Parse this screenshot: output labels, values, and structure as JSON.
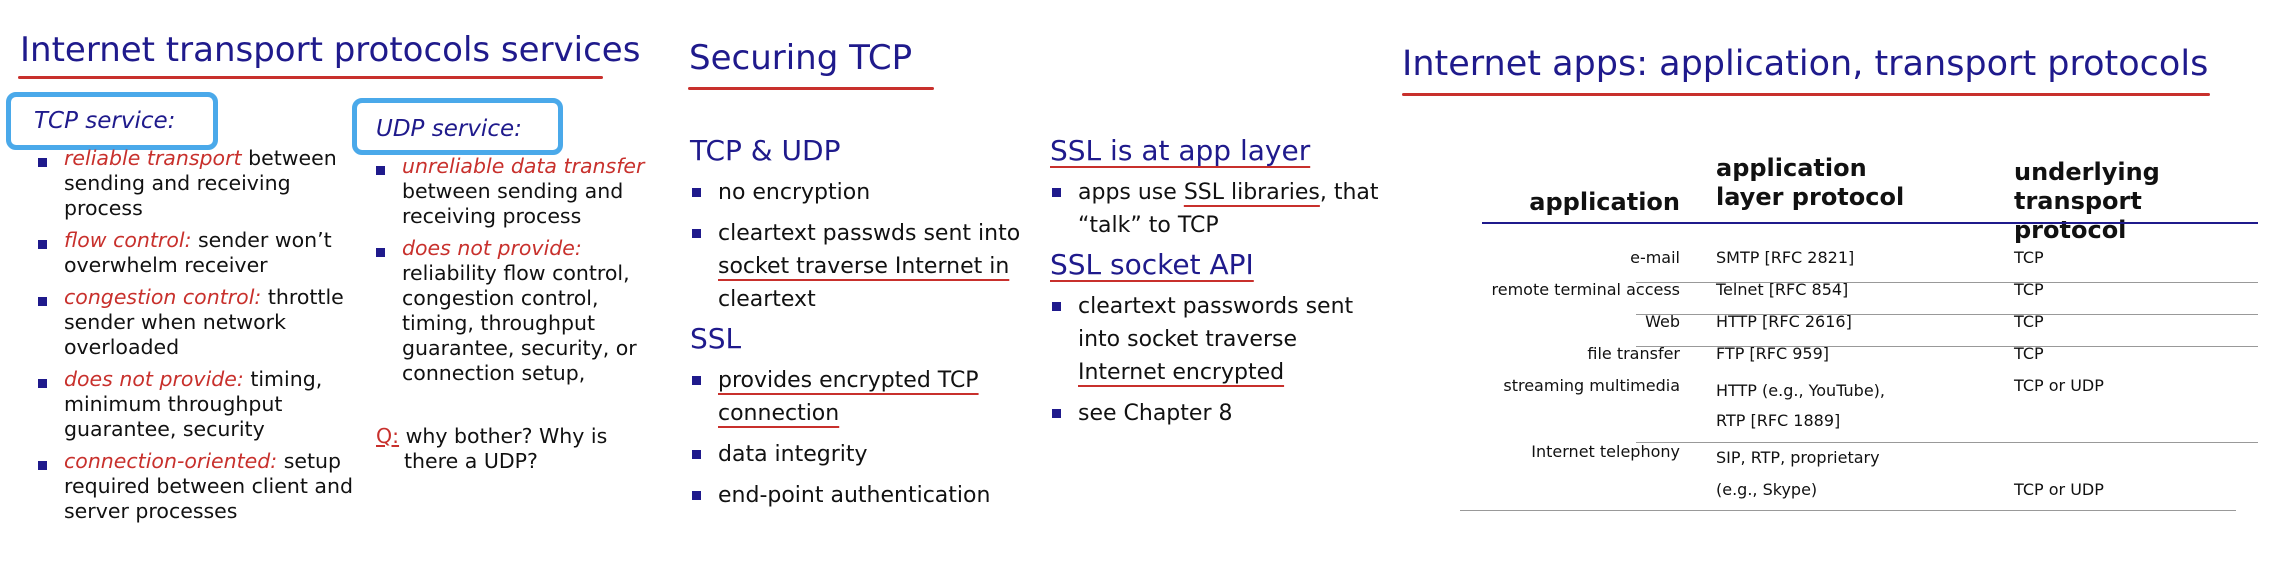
{
  "transport": {
    "title": "Internet transport protocols services",
    "tcp": {
      "label": "TCP service:",
      "items": [
        {
          "em": "reliable transport",
          "text": " between sending and receiving process"
        },
        {
          "em": "flow control:",
          "text": " sender won’t overwhelm receiver"
        },
        {
          "em": "congestion control:",
          "text": " throttle sender when network overloaded"
        },
        {
          "em": "does not provide:",
          "text": " timing, minimum throughput guarantee, security"
        },
        {
          "em": "connection-oriented:",
          "text": " setup required between client and server processes"
        }
      ]
    },
    "udp": {
      "label": "UDP service:",
      "items": [
        {
          "em": "unreliable data transfer",
          "text": " between sending and receiving process"
        },
        {
          "em": "does not provide:",
          "text": " reliability flow control, congestion control, timing, throughput guarantee, security, or connection setup,"
        }
      ],
      "q_label": "Q:",
      "q_text": " why bother?  Why is there a UDP?"
    }
  },
  "securing": {
    "title": "Securing TCP",
    "tcp_udp_heading": "TCP & UDP",
    "tcp_udp_items": [
      "no encryption",
      "cleartext passwds sent into",
      "socket traverse Internet  in",
      "cleartext"
    ],
    "ssl_heading": "SSL",
    "ssl_items": [
      "provides encrypted TCP",
      "connection",
      "data integrity",
      "end-point authentication"
    ],
    "app_layer_heading": "SSL is at app layer",
    "app_layer_item_pre": "apps use ",
    "app_layer_item_link": "SSL libraries",
    "app_layer_item_post": ", that",
    "app_layer_item_line2": "“talk” to TCP",
    "socket_api_heading": "SSL socket API",
    "socket_api_items": [
      "cleartext passwords sent",
      "into socket traverse",
      "Internet  encrypted"
    ],
    "see_chapter": "see Chapter 8"
  },
  "apps": {
    "title": "Internet apps:  application, transport protocols",
    "headers": {
      "application": "application",
      "app_protocol_1": "application",
      "app_protocol_2": "layer protocol",
      "transport_1": "underlying",
      "transport_2": "transport protocol"
    },
    "rows": [
      {
        "app": "e-mail",
        "proto": "SMTP [RFC 2821]",
        "proto2": "",
        "transport": "TCP",
        "transport2": ""
      },
      {
        "app": "remote terminal access",
        "proto": "Telnet [RFC 854]",
        "proto2": "",
        "transport": "TCP",
        "transport2": ""
      },
      {
        "app": "Web",
        "proto": "HTTP [RFC 2616]",
        "proto2": "",
        "transport": "TCP",
        "transport2": ""
      },
      {
        "app": "file transfer",
        "proto": "FTP [RFC 959]",
        "proto2": "",
        "transport": "TCP",
        "transport2": ""
      },
      {
        "app": "streaming multimedia",
        "proto": "HTTP (e.g., YouTube),",
        "proto2": "RTP [RFC 1889]",
        "transport": "TCP or UDP",
        "transport2": ""
      },
      {
        "app": "Internet telephony",
        "proto": "SIP, RTP, proprietary",
        "proto2": "(e.g., Skype)",
        "transport": "",
        "transport2": "TCP or UDP"
      }
    ]
  }
}
